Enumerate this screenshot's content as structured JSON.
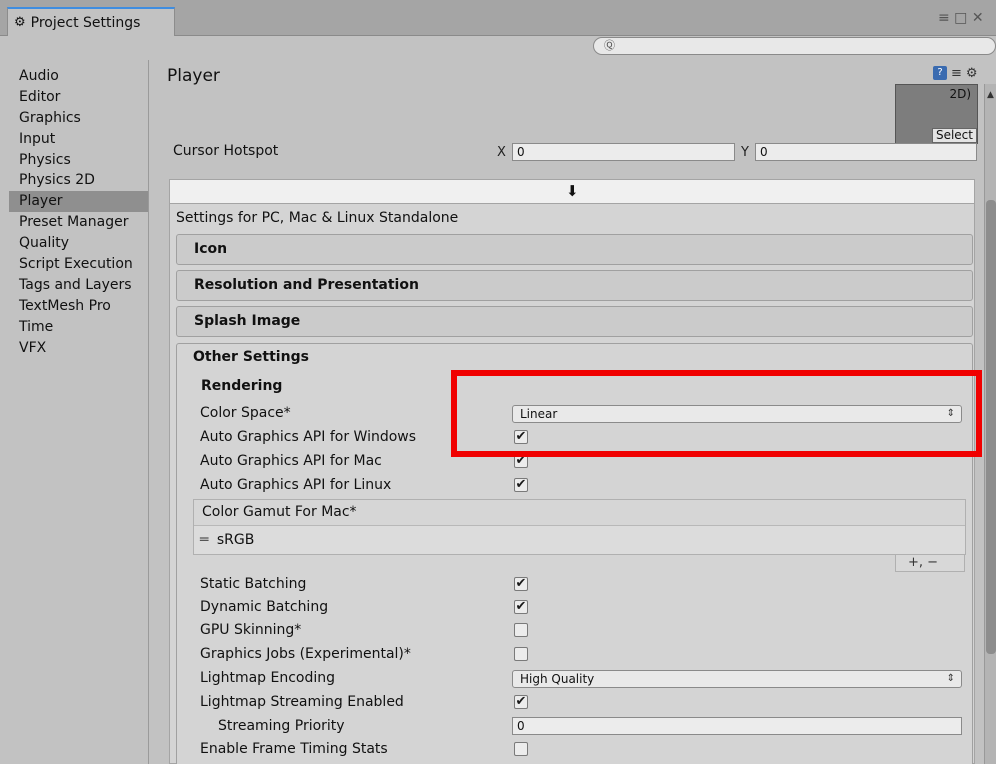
{
  "window": {
    "tab_title": "Project Settings",
    "controls": "≡ □ ✕",
    "search_placeholder": "Ⓠ"
  },
  "sidebar": {
    "items": [
      {
        "label": "Audio"
      },
      {
        "label": "Editor"
      },
      {
        "label": "Graphics"
      },
      {
        "label": "Input"
      },
      {
        "label": "Physics"
      },
      {
        "label": "Physics 2D"
      },
      {
        "label": "Player",
        "selected": true
      },
      {
        "label": "Preset Manager"
      },
      {
        "label": "Quality"
      },
      {
        "label": "Script Execution"
      },
      {
        "label": "Tags and Layers"
      },
      {
        "label": "TextMesh Pro"
      },
      {
        "label": "Time"
      },
      {
        "label": "VFX"
      }
    ]
  },
  "header": {
    "title": "Player",
    "thumb_label": "2D)",
    "thumb_select": "Select",
    "icons": [
      "help-icon",
      "layout-icon",
      "gear-icon"
    ]
  },
  "cursor_hotspot": {
    "label": "Cursor Hotspot",
    "x_label": "X",
    "x_value": "0",
    "y_label": "Y",
    "y_value": "0"
  },
  "platform": {
    "settings_for": "Settings for PC, Mac & Linux Standalone",
    "icon": "download-icon"
  },
  "sections": {
    "icon": "Icon",
    "resolution": "Resolution and Presentation",
    "splash": "Splash Image",
    "other": "Other Settings"
  },
  "rendering": {
    "title": "Rendering",
    "color_space_label": "Color Space*",
    "color_space_value": "Linear",
    "auto_win_label": "Auto Graphics API  for Windows",
    "auto_win": true,
    "auto_mac_label": "Auto Graphics API  for Mac",
    "auto_mac": true,
    "auto_linux_label": "Auto Graphics API  for Linux",
    "auto_linux": true,
    "gamut_header": "Color Gamut For Mac*",
    "gamut_item": "sRGB",
    "list_controls": "+,   −",
    "static_batching_label": "Static Batching",
    "static_batching": true,
    "dynamic_batching_label": "Dynamic Batching",
    "dynamic_batching": true,
    "gpu_skinning_label": "GPU Skinning*",
    "gpu_skinning": false,
    "graphics_jobs_label": "Graphics Jobs (Experimental)*",
    "graphics_jobs": false,
    "lightmap_encoding_label": "Lightmap Encoding",
    "lightmap_encoding_value": "High Quality",
    "lightmap_streaming_label": "Lightmap Streaming Enabled",
    "lightmap_streaming": true,
    "streaming_priority_label": "Streaming Priority",
    "streaming_priority_value": "0",
    "frame_timing_label": "Enable Frame Timing Stats",
    "frame_timing": false
  },
  "check_glyph": "✔",
  "colors": {
    "highlight": "#f00000",
    "selected_sidebar": "#8f8f8f",
    "accent_tab": "#3f8de0"
  }
}
